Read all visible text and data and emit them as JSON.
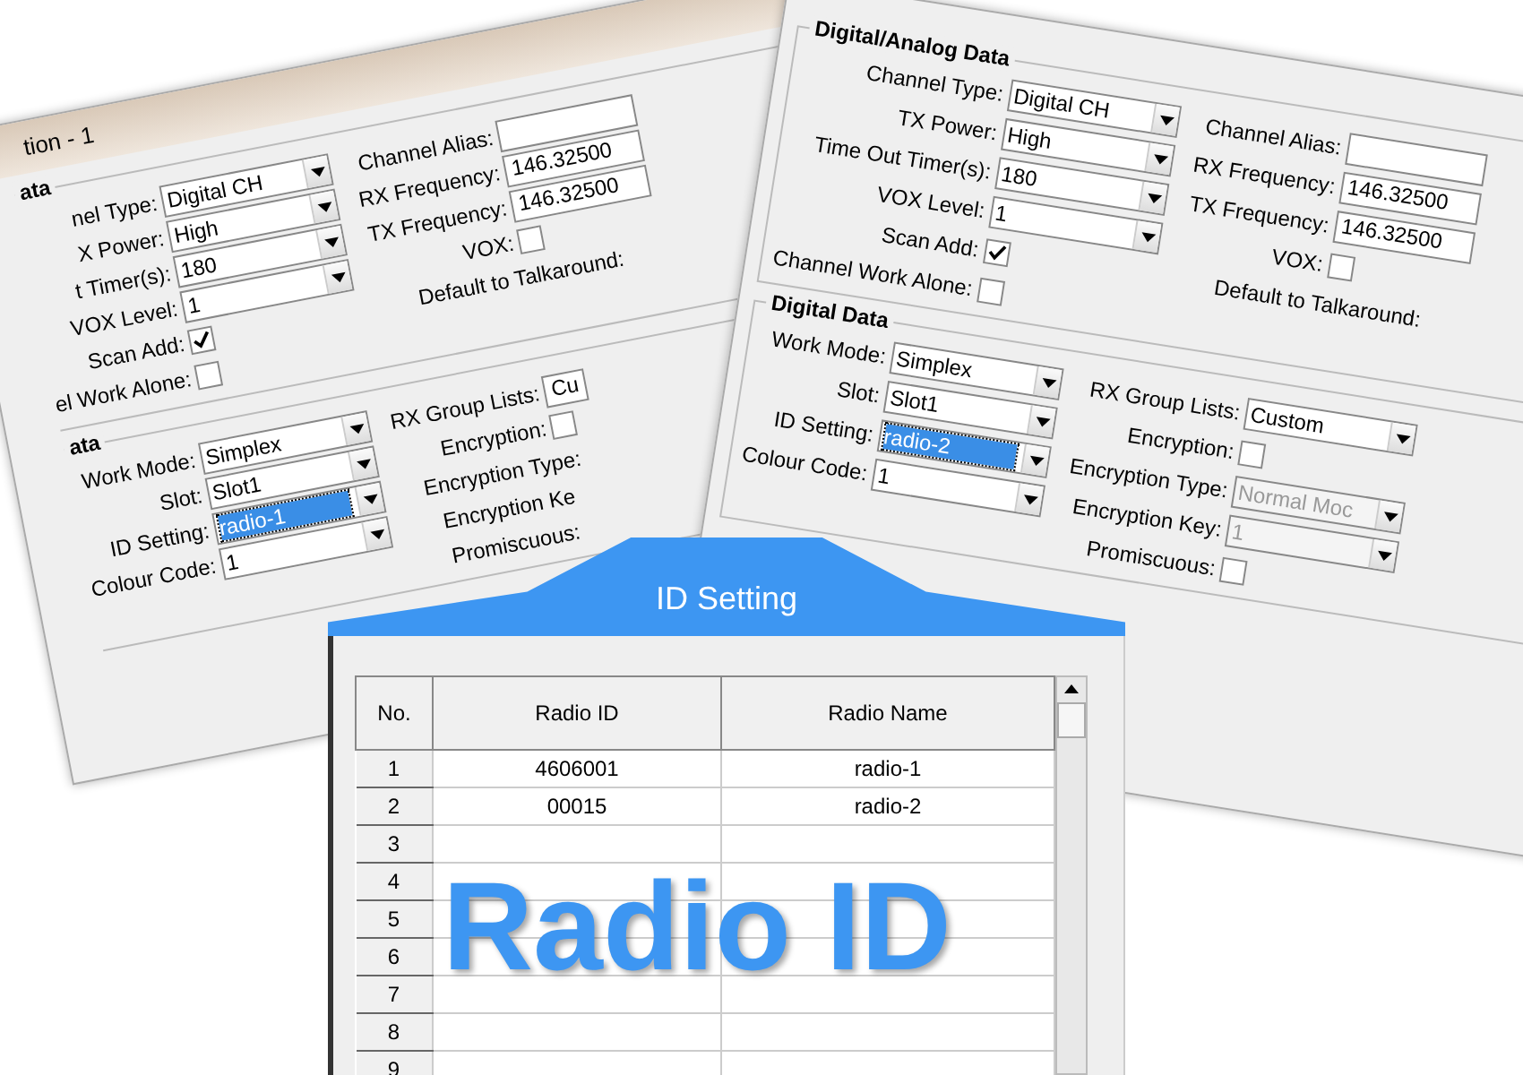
{
  "back_window": {
    "title": "tion - 1",
    "sections": [
      {
        "header": "ata",
        "left": [
          {
            "label": "nel Type:",
            "kind": "combo",
            "value": "Digital CH",
            "highlighted": false,
            "disabled": false
          },
          {
            "label": "X Power:",
            "kind": "combo",
            "value": "High",
            "highlighted": false,
            "disabled": false
          },
          {
            "label": "t Timer(s):",
            "kind": "combo",
            "value": "180",
            "highlighted": false,
            "disabled": false
          },
          {
            "label": "VOX Level:",
            "kind": "combo",
            "value": "1",
            "highlighted": false,
            "disabled": false
          },
          {
            "label": "Scan Add:",
            "kind": "check",
            "checked": true
          },
          {
            "label": "el Work Alone:",
            "kind": "check",
            "checked": false
          }
        ],
        "right": [
          {
            "label": "Channel Alias:",
            "kind": "text"
          },
          {
            "label": "RX Frequency:",
            "kind": "text",
            "value": "146.32500"
          },
          {
            "label": "TX Frequency:",
            "kind": "text",
            "value": "146.32500"
          },
          {
            "label": "VOX:",
            "kind": "check",
            "checked": false
          },
          {
            "label": "Default to Talkaround:",
            "kind": "label"
          }
        ]
      },
      {
        "header": "ata",
        "left": [
          {
            "label": "Work Mode:",
            "kind": "combo",
            "value": "Simplex",
            "highlighted": false,
            "disabled": false
          },
          {
            "label": "Slot:",
            "kind": "combo",
            "value": "Slot1",
            "highlighted": false,
            "disabled": false
          },
          {
            "label": "ID Setting:",
            "kind": "combo",
            "value": "radio-1",
            "highlighted": true,
            "disabled": false
          },
          {
            "label": "Colour Code:",
            "kind": "combo",
            "value": "1",
            "highlighted": false,
            "disabled": false
          }
        ],
        "right": [
          {
            "label": "RX Group Lists:",
            "kind": "text",
            "value": "Cu"
          },
          {
            "label": "Encryption:",
            "kind": "check",
            "checked": false
          },
          {
            "label": "Encryption Type:",
            "kind": "label"
          },
          {
            "label": "Encryption Ke",
            "kind": "label"
          },
          {
            "label": "Promiscuous:",
            "kind": "label"
          }
        ]
      }
    ]
  },
  "front_window": {
    "sections": [
      {
        "header": "Digital/Analog Data",
        "left": [
          {
            "label": "Channel Type:",
            "kind": "combo",
            "value": "Digital CH",
            "highlighted": false,
            "disabled": false
          },
          {
            "label": "TX Power:",
            "kind": "combo",
            "value": "High",
            "highlighted": false,
            "disabled": false
          },
          {
            "label": "Time Out Timer(s):",
            "kind": "combo",
            "value": "180",
            "highlighted": false,
            "disabled": false
          },
          {
            "label": "VOX Level:",
            "kind": "combo",
            "value": "1",
            "highlighted": false,
            "disabled": false
          },
          {
            "label": "Scan Add:",
            "kind": "check",
            "checked": true
          },
          {
            "label": "Channel Work Alone:",
            "kind": "check",
            "checked": false
          }
        ],
        "right": [
          {
            "label": "Channel Alias:",
            "kind": "text"
          },
          {
            "label": "RX Frequency:",
            "kind": "text",
            "value": "146.32500"
          },
          {
            "label": "TX Frequency:",
            "kind": "text",
            "value": "146.32500"
          },
          {
            "label": "VOX:",
            "kind": "check",
            "checked": false
          },
          {
            "label": "Default to Talkaround:",
            "kind": "label"
          }
        ]
      },
      {
        "header": "Digital Data",
        "left": [
          {
            "label": "Work Mode:",
            "kind": "combo",
            "value": "Simplex",
            "highlighted": false,
            "disabled": false
          },
          {
            "label": "Slot:",
            "kind": "combo",
            "value": "Slot1",
            "highlighted": false,
            "disabled": false
          },
          {
            "label": "ID Setting:",
            "kind": "combo",
            "value": "radio-2",
            "highlighted": true,
            "disabled": false
          },
          {
            "label": "Colour Code:",
            "kind": "combo",
            "value": "1",
            "highlighted": false,
            "disabled": false
          }
        ],
        "right": [
          {
            "label": "RX Group Lists:",
            "kind": "combo",
            "value": "Custom",
            "highlighted": false,
            "disabled": false
          },
          {
            "label": "Encryption:",
            "kind": "check",
            "checked": false
          },
          {
            "label": "Encryption Type:",
            "kind": "combo",
            "value": "Normal Moc",
            "highlighted": false,
            "disabled": true
          },
          {
            "label": "Encryption Key:",
            "kind": "combo",
            "value": "1",
            "highlighted": false,
            "disabled": true
          },
          {
            "label": "Promiscuous:",
            "kind": "check",
            "checked": false
          }
        ]
      }
    ]
  },
  "id_setting": {
    "title": "ID Setting",
    "columns": [
      "No.",
      "Radio ID",
      "Radio Name"
    ],
    "rows": [
      [
        "1",
        "4606001",
        "radio-1"
      ],
      [
        "2",
        "00015",
        "radio-2"
      ],
      [
        "3",
        "",
        ""
      ],
      [
        "4",
        "",
        ""
      ],
      [
        "5",
        "",
        ""
      ],
      [
        "6",
        "",
        ""
      ],
      [
        "7",
        "",
        ""
      ],
      [
        "8",
        "",
        ""
      ],
      [
        "9",
        "",
        ""
      ]
    ],
    "overlay_text": "Radio ID"
  }
}
